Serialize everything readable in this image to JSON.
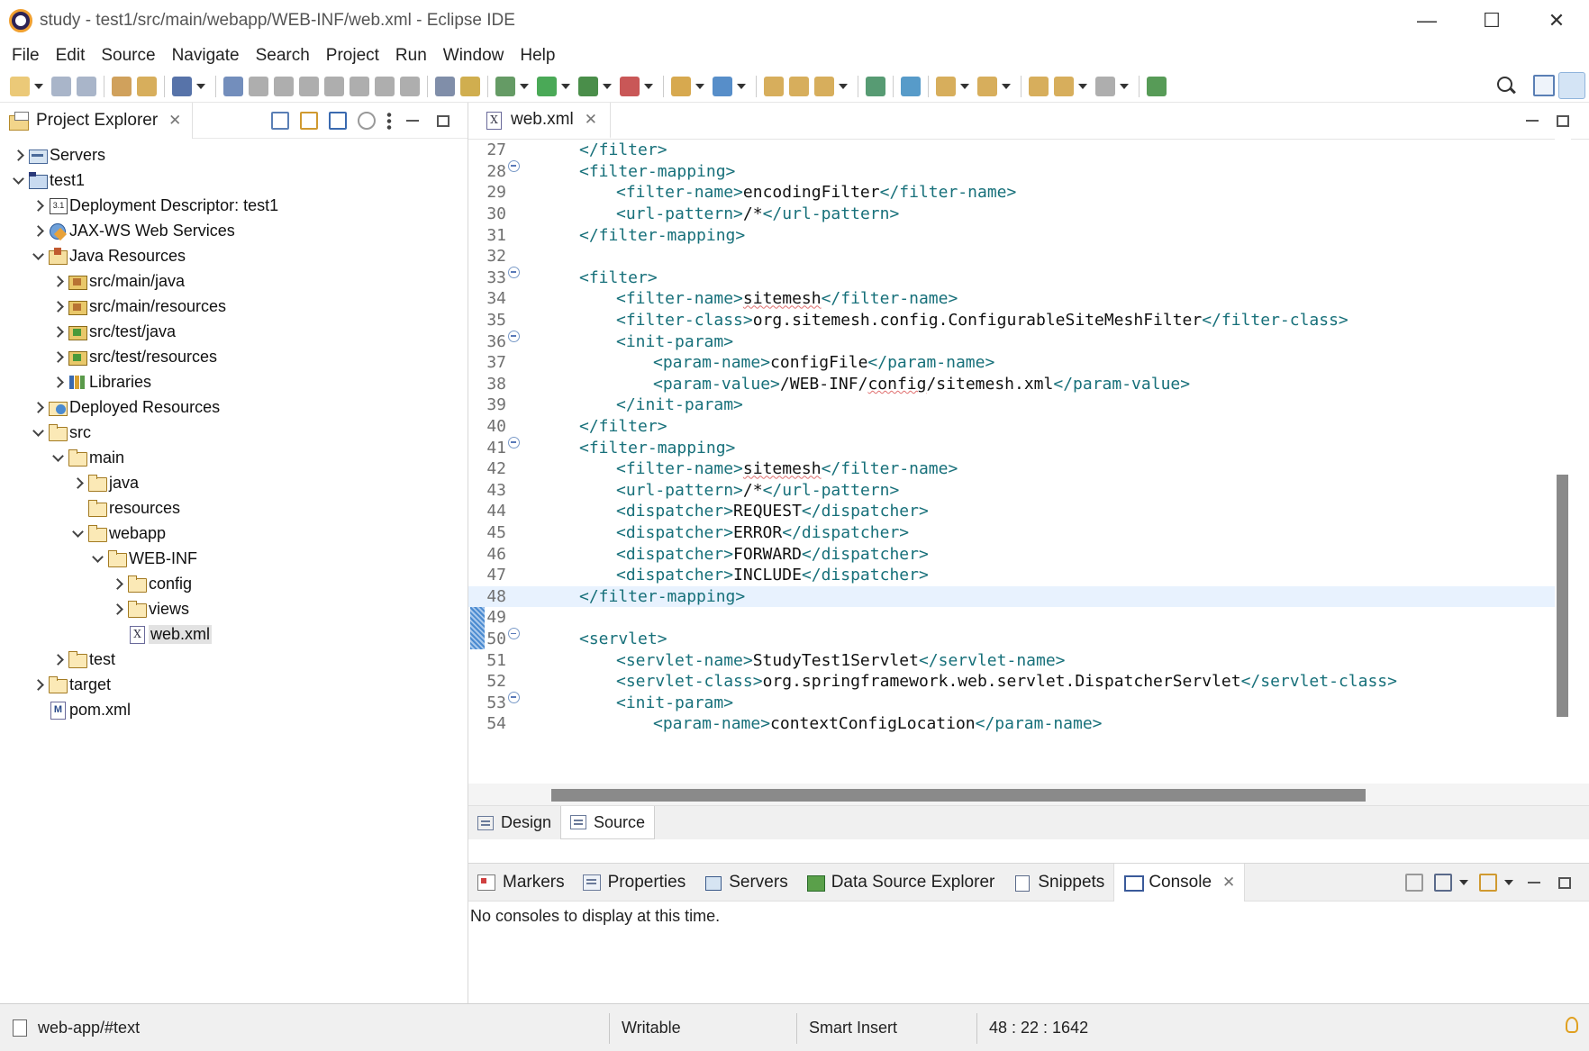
{
  "window": {
    "title": "study - test1/src/main/webapp/WEB-INF/web.xml - Eclipse IDE",
    "minimize": "—",
    "maximize": "☐",
    "close": "✕"
  },
  "menu": [
    "File",
    "Edit",
    "Source",
    "Navigate",
    "Search",
    "Project",
    "Run",
    "Window",
    "Help"
  ],
  "project_explorer": {
    "tab_label": "Project Explorer",
    "tree": [
      {
        "label": "Servers",
        "depth": 0,
        "expand": "collapsed",
        "icon": "server"
      },
      {
        "label": "test1",
        "depth": 0,
        "expand": "expanded",
        "icon": "project"
      },
      {
        "label": "Deployment Descriptor: test1",
        "depth": 1,
        "expand": "collapsed",
        "icon": "dd"
      },
      {
        "label": "JAX-WS Web Services",
        "depth": 1,
        "expand": "collapsed",
        "icon": "ws"
      },
      {
        "label": "Java Resources",
        "depth": 1,
        "expand": "expanded",
        "icon": "jr"
      },
      {
        "label": "src/main/java",
        "depth": 2,
        "expand": "collapsed",
        "icon": "pkg"
      },
      {
        "label": "src/main/resources",
        "depth": 2,
        "expand": "collapsed",
        "icon": "pkg"
      },
      {
        "label": "src/test/java",
        "depth": 2,
        "expand": "collapsed",
        "icon": "pkgtest"
      },
      {
        "label": "src/test/resources",
        "depth": 2,
        "expand": "collapsed",
        "icon": "pkgtest"
      },
      {
        "label": "Libraries",
        "depth": 2,
        "expand": "collapsed",
        "icon": "lib"
      },
      {
        "label": "Deployed Resources",
        "depth": 1,
        "expand": "collapsed",
        "icon": "deployed"
      },
      {
        "label": "src",
        "depth": 1,
        "expand": "expanded",
        "icon": "folder"
      },
      {
        "label": "main",
        "depth": 2,
        "expand": "expanded",
        "icon": "folder"
      },
      {
        "label": "java",
        "depth": 3,
        "expand": "collapsed",
        "icon": "folder"
      },
      {
        "label": "resources",
        "depth": 3,
        "expand": "none",
        "icon": "folder"
      },
      {
        "label": "webapp",
        "depth": 3,
        "expand": "expanded",
        "icon": "folder"
      },
      {
        "label": "WEB-INF",
        "depth": 4,
        "expand": "expanded",
        "icon": "folder"
      },
      {
        "label": "config",
        "depth": 5,
        "expand": "collapsed",
        "icon": "folder"
      },
      {
        "label": "views",
        "depth": 5,
        "expand": "collapsed",
        "icon": "folder"
      },
      {
        "label": "web.xml",
        "depth": 5,
        "expand": "none",
        "icon": "xmlfile",
        "selected": true
      },
      {
        "label": "test",
        "depth": 2,
        "expand": "collapsed",
        "icon": "folder"
      },
      {
        "label": "target",
        "depth": 1,
        "expand": "collapsed",
        "icon": "folder"
      },
      {
        "label": "pom.xml",
        "depth": 1,
        "expand": "none",
        "icon": "pomfile"
      }
    ]
  },
  "editor": {
    "tab_label": "web.xml",
    "current_line": 48,
    "lines": [
      {
        "n": "27",
        "fold": false,
        "indent": 1,
        "parts": [
          [
            "t",
            "</filter>"
          ]
        ]
      },
      {
        "n": "28",
        "fold": true,
        "indent": 1,
        "parts": [
          [
            "t",
            "<filter-mapping>"
          ]
        ]
      },
      {
        "n": "29",
        "fold": false,
        "indent": 2,
        "parts": [
          [
            "t",
            "<filter-name>"
          ],
          [
            "x",
            "encodingFilter"
          ],
          [
            "t",
            "</filter-name>"
          ]
        ]
      },
      {
        "n": "30",
        "fold": false,
        "indent": 2,
        "parts": [
          [
            "t",
            "<url-pattern>"
          ],
          [
            "x",
            "/*"
          ],
          [
            "t",
            "</url-pattern>"
          ]
        ]
      },
      {
        "n": "31",
        "fold": false,
        "indent": 1,
        "parts": [
          [
            "t",
            "</filter-mapping>"
          ]
        ]
      },
      {
        "n": "32",
        "fold": false,
        "indent": 0,
        "parts": []
      },
      {
        "n": "33",
        "fold": true,
        "indent": 1,
        "parts": [
          [
            "t",
            "<filter>"
          ]
        ]
      },
      {
        "n": "34",
        "fold": false,
        "indent": 2,
        "parts": [
          [
            "t",
            "<filter-name>"
          ],
          [
            "s",
            "sitemesh"
          ],
          [
            "t",
            "</filter-name>"
          ]
        ]
      },
      {
        "n": "35",
        "fold": false,
        "indent": 2,
        "parts": [
          [
            "t",
            "<filter-class>"
          ],
          [
            "x",
            "org.sitemesh.config.ConfigurableSiteMeshFilter"
          ],
          [
            "t",
            "</filter-class>"
          ]
        ]
      },
      {
        "n": "36",
        "fold": true,
        "indent": 2,
        "parts": [
          [
            "t",
            "<init-param>"
          ]
        ]
      },
      {
        "n": "37",
        "fold": false,
        "indent": 3,
        "parts": [
          [
            "t",
            "<param-name>"
          ],
          [
            "x",
            "configFile"
          ],
          [
            "t",
            "</param-name>"
          ]
        ]
      },
      {
        "n": "38",
        "fold": false,
        "indent": 3,
        "parts": [
          [
            "t",
            "<param-value>"
          ],
          [
            "x",
            "/WEB-INF/"
          ],
          [
            "s",
            "config"
          ],
          [
            "x",
            "/sitemesh.xml"
          ],
          [
            "t",
            "</param-value>"
          ]
        ]
      },
      {
        "n": "39",
        "fold": false,
        "indent": 2,
        "parts": [
          [
            "t",
            "</init-param>"
          ]
        ]
      },
      {
        "n": "40",
        "fold": false,
        "indent": 1,
        "parts": [
          [
            "t",
            "</filter>"
          ]
        ]
      },
      {
        "n": "41",
        "fold": true,
        "indent": 1,
        "parts": [
          [
            "t",
            "<filter-mapping>"
          ]
        ]
      },
      {
        "n": "42",
        "fold": false,
        "indent": 2,
        "parts": [
          [
            "t",
            "<filter-name>"
          ],
          [
            "s",
            "sitemesh"
          ],
          [
            "t",
            "</filter-name>"
          ]
        ]
      },
      {
        "n": "43",
        "fold": false,
        "indent": 2,
        "parts": [
          [
            "t",
            "<url-pattern>"
          ],
          [
            "x",
            "/*"
          ],
          [
            "t",
            "</url-pattern>"
          ]
        ]
      },
      {
        "n": "44",
        "fold": false,
        "indent": 2,
        "parts": [
          [
            "t",
            "<dispatcher>"
          ],
          [
            "x",
            "REQUEST"
          ],
          [
            "t",
            "</dispatcher>"
          ]
        ]
      },
      {
        "n": "45",
        "fold": false,
        "indent": 2,
        "parts": [
          [
            "t",
            "<dispatcher>"
          ],
          [
            "x",
            "ERROR"
          ],
          [
            "t",
            "</dispatcher>"
          ]
        ]
      },
      {
        "n": "46",
        "fold": false,
        "indent": 2,
        "parts": [
          [
            "t",
            "<dispatcher>"
          ],
          [
            "x",
            "FORWARD"
          ],
          [
            "t",
            "</dispatcher>"
          ]
        ]
      },
      {
        "n": "47",
        "fold": false,
        "indent": 2,
        "parts": [
          [
            "t",
            "<dispatcher>"
          ],
          [
            "x",
            "INCLUDE"
          ],
          [
            "t",
            "</dispatcher>"
          ]
        ]
      },
      {
        "n": "48",
        "fold": false,
        "indent": 1,
        "parts": [
          [
            "t",
            "</filter-mapping>"
          ]
        ]
      },
      {
        "n": "49",
        "fold": false,
        "indent": 0,
        "parts": []
      },
      {
        "n": "50",
        "fold": true,
        "indent": 1,
        "parts": [
          [
            "t",
            "<servlet>"
          ]
        ]
      },
      {
        "n": "51",
        "fold": false,
        "indent": 2,
        "parts": [
          [
            "t",
            "<servlet-name>"
          ],
          [
            "x",
            "StudyTest1Servlet"
          ],
          [
            "t",
            "</servlet-name>"
          ]
        ]
      },
      {
        "n": "52",
        "fold": false,
        "indent": 2,
        "parts": [
          [
            "t",
            "<servlet-class>"
          ],
          [
            "x",
            "org.springframework.web.servlet.DispatcherServlet"
          ],
          [
            "t",
            "</servlet-class>"
          ]
        ]
      },
      {
        "n": "53",
        "fold": true,
        "indent": 2,
        "parts": [
          [
            "t",
            "<init-param>"
          ]
        ]
      },
      {
        "n": "54",
        "fold": false,
        "indent": 3,
        "parts": [
          [
            "t",
            "<param-name>"
          ],
          [
            "x",
            "contextConfigLocation"
          ],
          [
            "t",
            "</param-name>"
          ]
        ]
      }
    ],
    "bottom_tabs": {
      "design": "Design",
      "source": "Source"
    }
  },
  "bottom_panel": {
    "tabs": [
      {
        "label": "Markers",
        "icon": "markers"
      },
      {
        "label": "Properties",
        "icon": "props"
      },
      {
        "label": "Servers",
        "icon": "servers"
      },
      {
        "label": "Data Source Explorer",
        "icon": "dse"
      },
      {
        "label": "Snippets",
        "icon": "snip"
      },
      {
        "label": "Console",
        "icon": "console",
        "active": true
      }
    ],
    "console_message": "No consoles to display at this time."
  },
  "statusbar": {
    "path": "web-app/#text",
    "writable": "Writable",
    "insert_mode": "Smart Insert",
    "position": "48 : 22 : 1642"
  }
}
